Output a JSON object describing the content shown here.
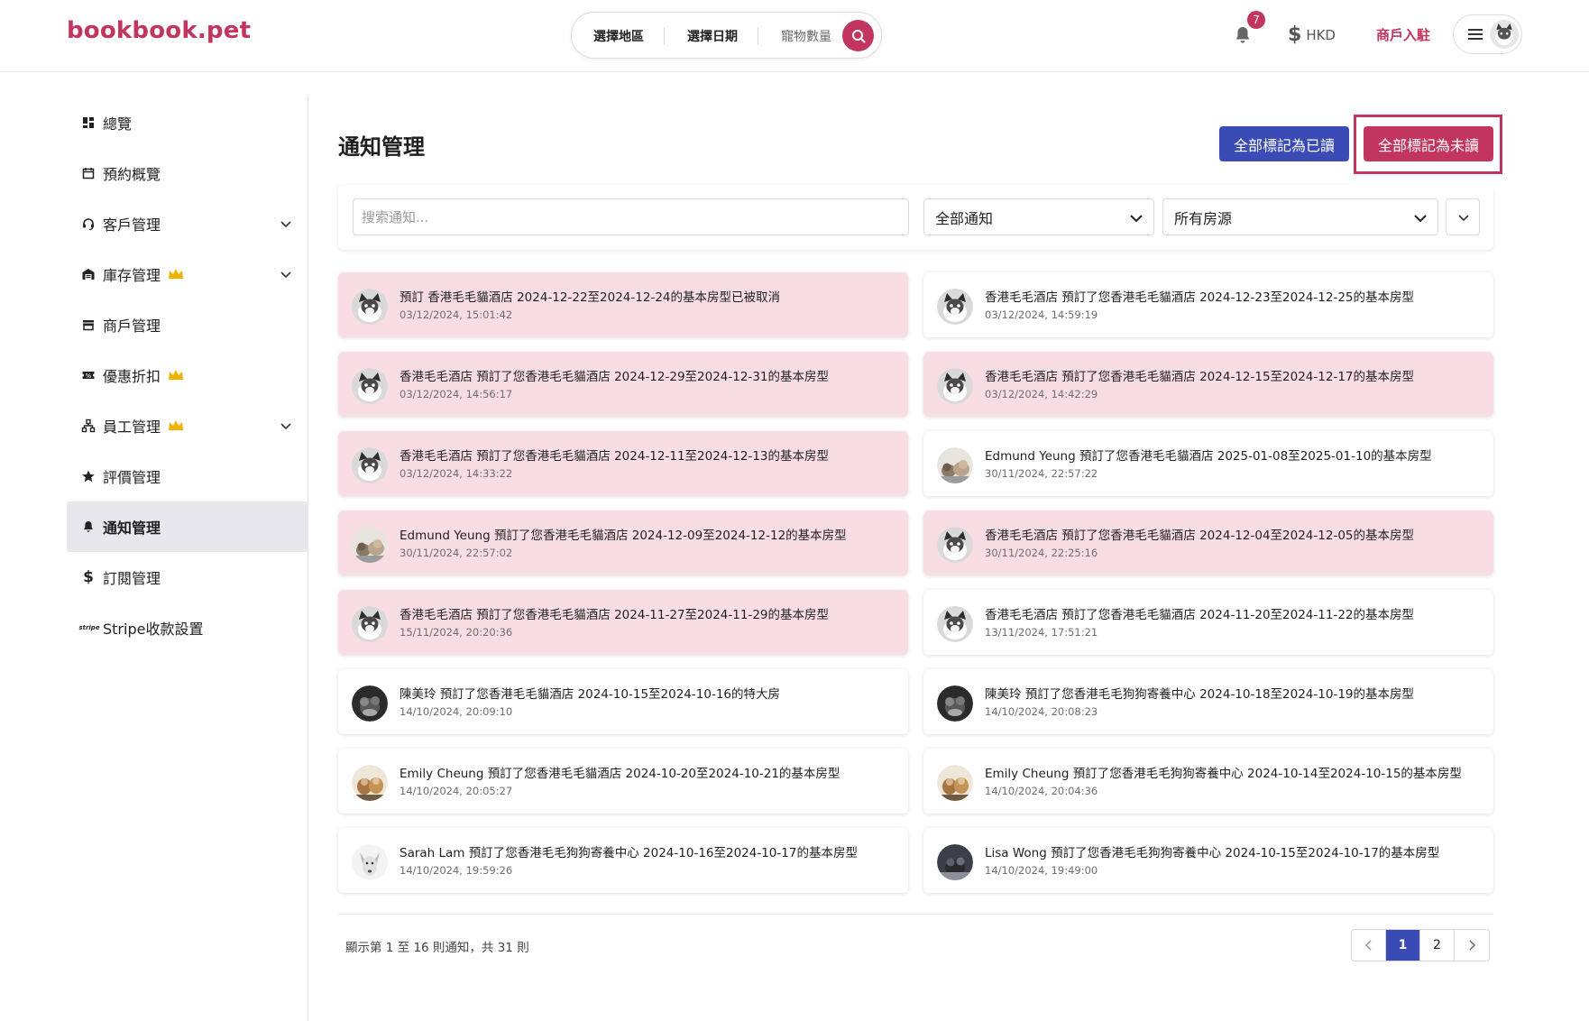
{
  "header": {
    "logo": "bookbook.pet",
    "search": {
      "region": "選擇地區",
      "date": "選擇日期",
      "pets": "寵物數量"
    },
    "notification_count": "7",
    "currency": "HKD",
    "merchant_link": "商戶入駐"
  },
  "sidebar": {
    "items": [
      {
        "label": "總覽",
        "icon": "dashboard-icon"
      },
      {
        "label": "預約概覽",
        "icon": "calendar-icon"
      },
      {
        "label": "客戶管理",
        "icon": "headset-icon"
      },
      {
        "label": "庫存管理",
        "icon": "warehouse-icon"
      },
      {
        "label": "商戶管理",
        "icon": "store-icon"
      },
      {
        "label": "優惠折扣",
        "icon": "ticket-icon"
      },
      {
        "label": "員工管理",
        "icon": "org-chart-icon"
      },
      {
        "label": "評價管理",
        "icon": "star-icon"
      },
      {
        "label": "通知管理",
        "icon": "bell-icon"
      },
      {
        "label": "訂閱管理",
        "icon": "dollar-icon"
      },
      {
        "label": "Stripe收款設置",
        "icon": "stripe-icon"
      }
    ]
  },
  "main": {
    "title": "通知管理",
    "mark_all_read": "全部標記為已讀",
    "mark_all_unread": "全部標記為未讀",
    "search_placeholder": "搜索通知...",
    "filter_type": "全部通知",
    "filter_property": "所有房源"
  },
  "notifications": [
    {
      "message": "預訂 香港毛毛貓酒店 2024-12-22至2024-12-24的基本房型已被取消",
      "time": "03/12/2024, 15:01:42",
      "unread": true,
      "avatar": "cat"
    },
    {
      "message": "香港毛毛酒店 預訂了您香港毛毛貓酒店 2024-12-23至2024-12-25的基本房型",
      "time": "03/12/2024, 14:59:19",
      "unread": false,
      "avatar": "cat"
    },
    {
      "message": "香港毛毛酒店 預訂了您香港毛毛貓酒店 2024-12-29至2024-12-31的基本房型",
      "time": "03/12/2024, 14:56:17",
      "unread": true,
      "avatar": "cat"
    },
    {
      "message": "香港毛毛酒店 預訂了您香港毛毛貓酒店 2024-12-15至2024-12-17的基本房型",
      "time": "03/12/2024, 14:42:29",
      "unread": true,
      "avatar": "cat"
    },
    {
      "message": "香港毛毛酒店 預訂了您香港毛毛貓酒店 2024-12-11至2024-12-13的基本房型",
      "time": "03/12/2024, 14:33:22",
      "unread": true,
      "avatar": "cat"
    },
    {
      "message": "Edmund Yeung 預訂了您香港毛毛貓酒店 2025-01-08至2025-01-10的基本房型",
      "time": "30/11/2024, 22:57:22",
      "unread": false,
      "avatar": "dogs"
    },
    {
      "message": "Edmund Yeung 預訂了您香港毛毛貓酒店 2024-12-09至2024-12-12的基本房型",
      "time": "30/11/2024, 22:57:02",
      "unread": true,
      "avatar": "dogs"
    },
    {
      "message": "香港毛毛酒店 預訂了您香港毛毛貓酒店 2024-12-04至2024-12-05的基本房型",
      "time": "30/11/2024, 22:25:16",
      "unread": true,
      "avatar": "cat"
    },
    {
      "message": "香港毛毛酒店 預訂了您香港毛毛貓酒店 2024-11-27至2024-11-29的基本房型",
      "time": "15/11/2024, 20:20:36",
      "unread": true,
      "avatar": "cat"
    },
    {
      "message": "香港毛毛酒店 預訂了您香港毛毛貓酒店 2024-11-20至2024-11-22的基本房型",
      "time": "13/11/2024, 17:51:21",
      "unread": false,
      "avatar": "cat"
    },
    {
      "message": "陳美玲 預訂了您香港毛毛貓酒店 2024-10-15至2024-10-16的特大房",
      "time": "14/10/2024, 20:09:10",
      "unread": false,
      "avatar": "dark"
    },
    {
      "message": "陳美玲 預訂了您香港毛毛狗狗寄養中心 2024-10-18至2024-10-19的基本房型",
      "time": "14/10/2024, 20:08:23",
      "unread": false,
      "avatar": "dark"
    },
    {
      "message": "Emily Cheung 預訂了您香港毛毛貓酒店 2024-10-20至2024-10-21的基本房型",
      "time": "14/10/2024, 20:05:27",
      "unread": false,
      "avatar": "brown"
    },
    {
      "message": "Emily Cheung 預訂了您香港毛毛狗狗寄養中心 2024-10-14至2024-10-15的基本房型",
      "time": "14/10/2024, 20:04:36",
      "unread": false,
      "avatar": "brown"
    },
    {
      "message": "Sarah Lam 預訂了您香港毛毛狗狗寄養中心 2024-10-16至2024-10-17的基本房型",
      "time": "14/10/2024, 19:59:26",
      "unread": false,
      "avatar": "white"
    },
    {
      "message": "Lisa Wong 預訂了您香港毛毛狗狗寄養中心 2024-10-15至2024-10-17的基本房型",
      "time": "14/10/2024, 19:49:00",
      "unread": false,
      "avatar": "night"
    }
  ],
  "footer": {
    "summary": "顯示第 1 至 16 則通知，共 31 則",
    "pages": [
      "1",
      "2"
    ],
    "current_page": "1"
  },
  "colors": {
    "brand": "#c2355f",
    "primary": "#3a4bb5",
    "unread_bg": "#f9dde5"
  }
}
